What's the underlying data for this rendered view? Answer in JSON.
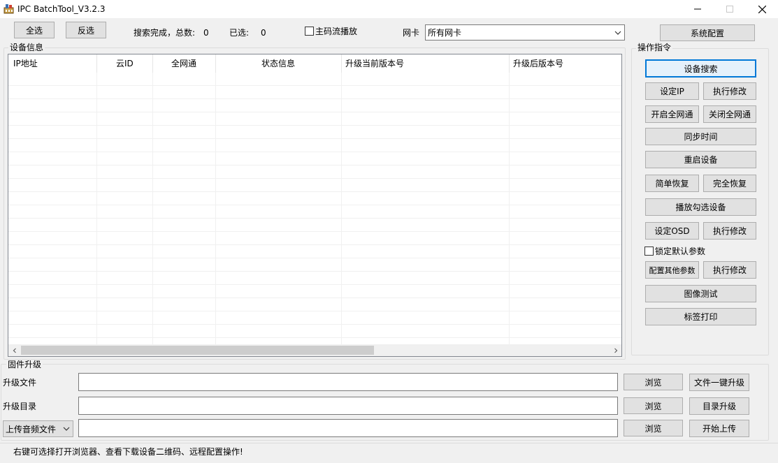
{
  "window": {
    "title": "IPC BatchTool_V3.2.3",
    "minimize": "—",
    "maximize": "☐",
    "close": "✕"
  },
  "toolbar": {
    "select_all": "全选",
    "invert_select": "反选",
    "search_status_label": "搜索完成，总数:",
    "search_total": "0",
    "selected_label": "已选:",
    "selected_count": "0",
    "main_stream_label": "主码流播放",
    "nic_label": "网卡",
    "nic_value": "所有网卡",
    "system_config": "系统配置"
  },
  "device_info": {
    "title": "设备信息",
    "columns": [
      "IP地址",
      "云ID",
      "全网通",
      "状态信息",
      "升级当前版本号",
      "升级后版本号"
    ],
    "rows": []
  },
  "operations": {
    "title": "操作指令",
    "device_search": "设备搜索",
    "set_ip": "设定IP",
    "execute_modify_1": "执行修改",
    "enable_all_net": "开启全网通",
    "disable_all_net": "关闭全网通",
    "sync_time": "同步时间",
    "reboot_device": "重启设备",
    "simple_restore": "简单恢复",
    "full_restore": "完全恢复",
    "play_checked": "播放勾选设备",
    "set_osd": "设定OSD",
    "execute_modify_2": "执行修改",
    "lock_default_params": "锁定默认参数",
    "config_other_params": "配置其他参数",
    "execute_modify_3": "执行修改",
    "image_test": "图像测试",
    "label_print": "标签打印"
  },
  "firmware": {
    "title": "固件升级",
    "upgrade_file_label": "升级文件",
    "upgrade_file_value": "",
    "upgrade_dir_label": "升级目录",
    "upgrade_dir_value": "",
    "upload_type_value": "上传音频文件",
    "upload_value": "",
    "browse": "浏览",
    "file_upgrade": "文件一键升级",
    "dir_upgrade": "目录升级",
    "start_upload": "开始上传"
  },
  "status": {
    "hint": "右键可选择打开浏览器、查看下载设备二维码、远程配置操作!"
  },
  "colors": {
    "focus_border": "#0078d7",
    "button_bg": "#e1e1e1",
    "window_bg": "#f0f0f0"
  }
}
